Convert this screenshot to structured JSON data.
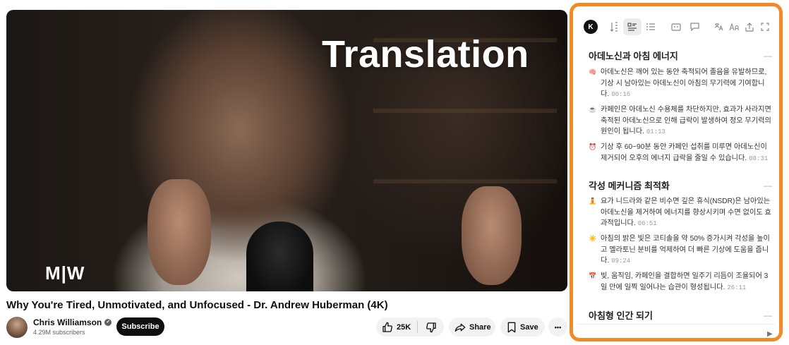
{
  "video": {
    "overlay_text": "Translation",
    "watermark": "M|W",
    "title": "Why You're Tired, Unmotivated, and Unfocused - Dr. Andrew Huberman (4K)"
  },
  "channel": {
    "name": "Chris Williamson",
    "subscribers": "4.29M subscribers",
    "subscribe_label": "Subscribe"
  },
  "actions": {
    "likes": "25K",
    "share_label": "Share",
    "save_label": "Save",
    "more_label": "•••"
  },
  "panel": {
    "logo": "K",
    "toolbar_icons": [
      "logo-icon",
      "sort-icon",
      "summary-icon",
      "list-icon",
      "subtitle-icon",
      "chat-icon",
      "translate-icon",
      "font-size-icon",
      "export-icon",
      "fullscreen-icon"
    ],
    "sections": [
      {
        "title": "아데노신과 아침 에너지",
        "items": [
          {
            "emoji": "🧠",
            "text": "아데노신은 깨어 있는 동안 축적되어 졸음을 유발하므로, 기상 시 남아있는 아데노신이 아침의 무기력에 기여합니다.",
            "time": "00:16"
          },
          {
            "emoji": "☕",
            "text": "카페인은 아데노신 수용체를 차단하지만, 효과가 사라지면 축적된 아데노신으로 인해 급락이 발생하여 정오 무기력의 원인이 됩니다.",
            "time": "01:13"
          },
          {
            "emoji": "⏰",
            "text": "기상 후 60~90분 동안 카페인 섭취를 미루면 아데노신이 제거되어 오후의 에너지 급락을 줄일 수 있습니다.",
            "time": "08:31"
          }
        ]
      },
      {
        "title": "각성 메커니즘 최적화",
        "items": [
          {
            "emoji": "🧘",
            "text": "요가 니드라와 같은 비수면 깊은 휴식(NSDR)은 남아있는 아데노신을 제거하여 에너지를 향상시키며 수면 없이도 효과적입니다.",
            "time": "06:51"
          },
          {
            "emoji": "☀️",
            "text": "아침의 밝은 빛은 코티솔을 약 50% 증가시켜 각성을 높이고 멜라토닌 분비를 억제하여 더 빠른 기상에 도움을 줍니다.",
            "time": "09:24"
          },
          {
            "emoji": "📅",
            "text": "빛, 움직임, 카페인을 결합하면 일주기 리듬이 조율되어 3일 만에 일찍 일어나는 습관이 형성됩니다.",
            "time": "26:11"
          }
        ]
      },
      {
        "title": "아침형 인간 되기",
        "items": []
      }
    ],
    "collapse_symbol": "—",
    "send_symbol": "▶"
  },
  "colors": {
    "panel_border": "#f28a25",
    "subscribe_bg": "#0f0f0f",
    "pill_bg": "#f2f2f2"
  }
}
